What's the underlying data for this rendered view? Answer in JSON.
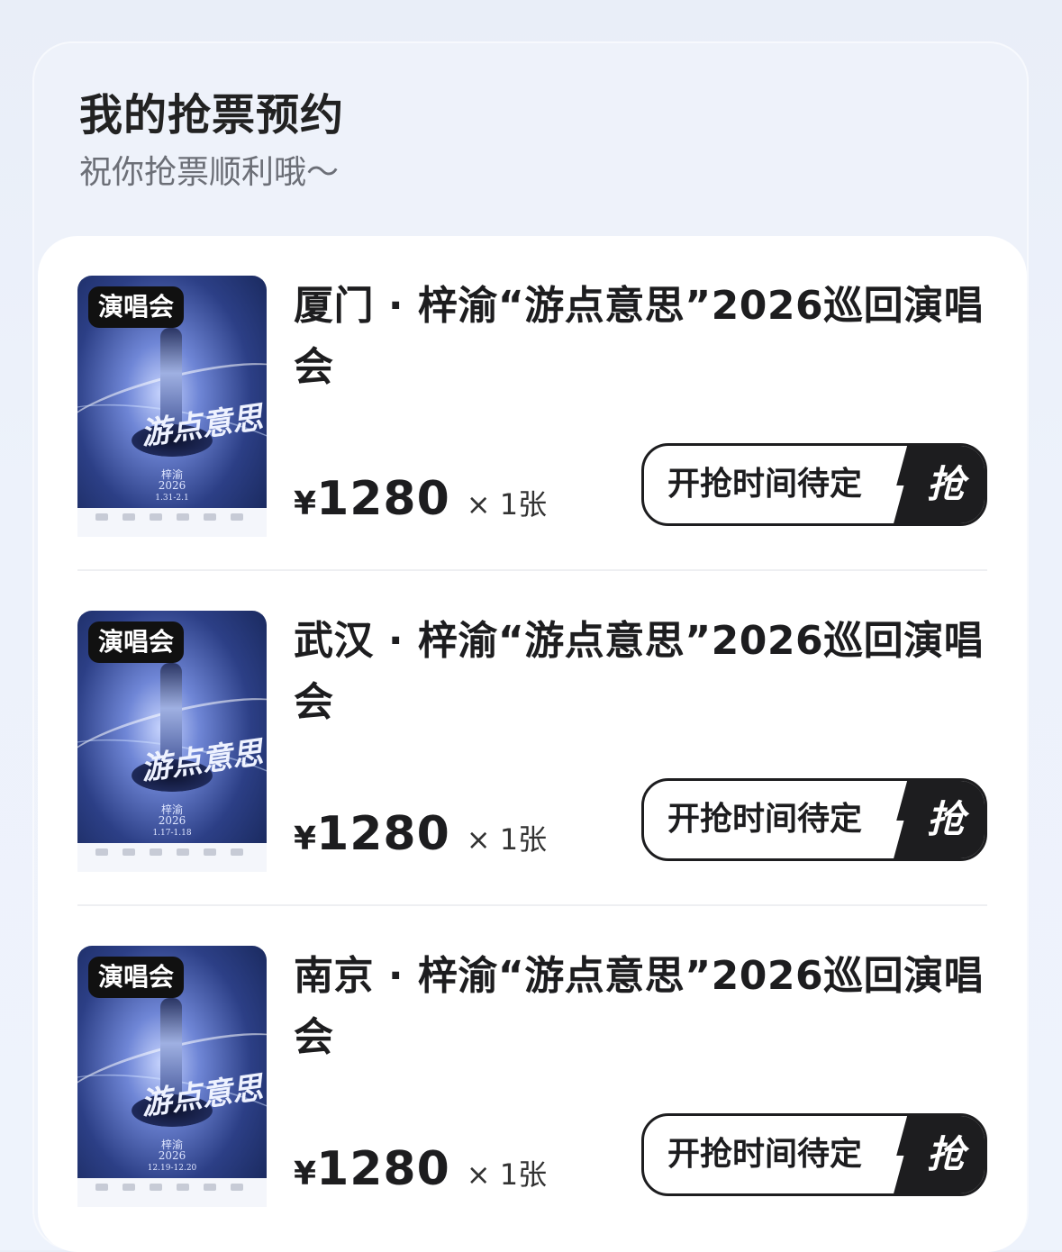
{
  "header": {
    "title": "我的抢票预约",
    "subtitle": "祝你抢票顺利哦～"
  },
  "items": [
    {
      "badge": "演唱会",
      "name": "厦门 · 梓渝“游点意思”2026巡回演唱会",
      "price_symbol": "¥",
      "price": "1280",
      "quantity": "× 1张",
      "button_label": "开抢时间待定",
      "button_icon_label": "抢",
      "poster_date": "1.31-2.1"
    },
    {
      "badge": "演唱会",
      "name": "武汉 · 梓渝“游点意思”2026巡回演唱会",
      "price_symbol": "¥",
      "price": "1280",
      "quantity": "× 1张",
      "button_label": "开抢时间待定",
      "button_icon_label": "抢",
      "poster_date": "1.17-1.18"
    },
    {
      "badge": "演唱会",
      "name": "南京 · 梓渝“游点意思”2026巡回演唱会",
      "price_symbol": "¥",
      "price": "1280",
      "quantity": "× 1张",
      "button_label": "开抢时间待定",
      "button_icon_label": "抢",
      "poster_date": "12.19-12.20"
    }
  ],
  "poster": {
    "calligraphy": "游点意思",
    "artist": "梓渝",
    "year": "2026"
  },
  "colors": {
    "accent": "#1d1d1f",
    "background": "#eef2fa",
    "card": "#ffffff"
  }
}
